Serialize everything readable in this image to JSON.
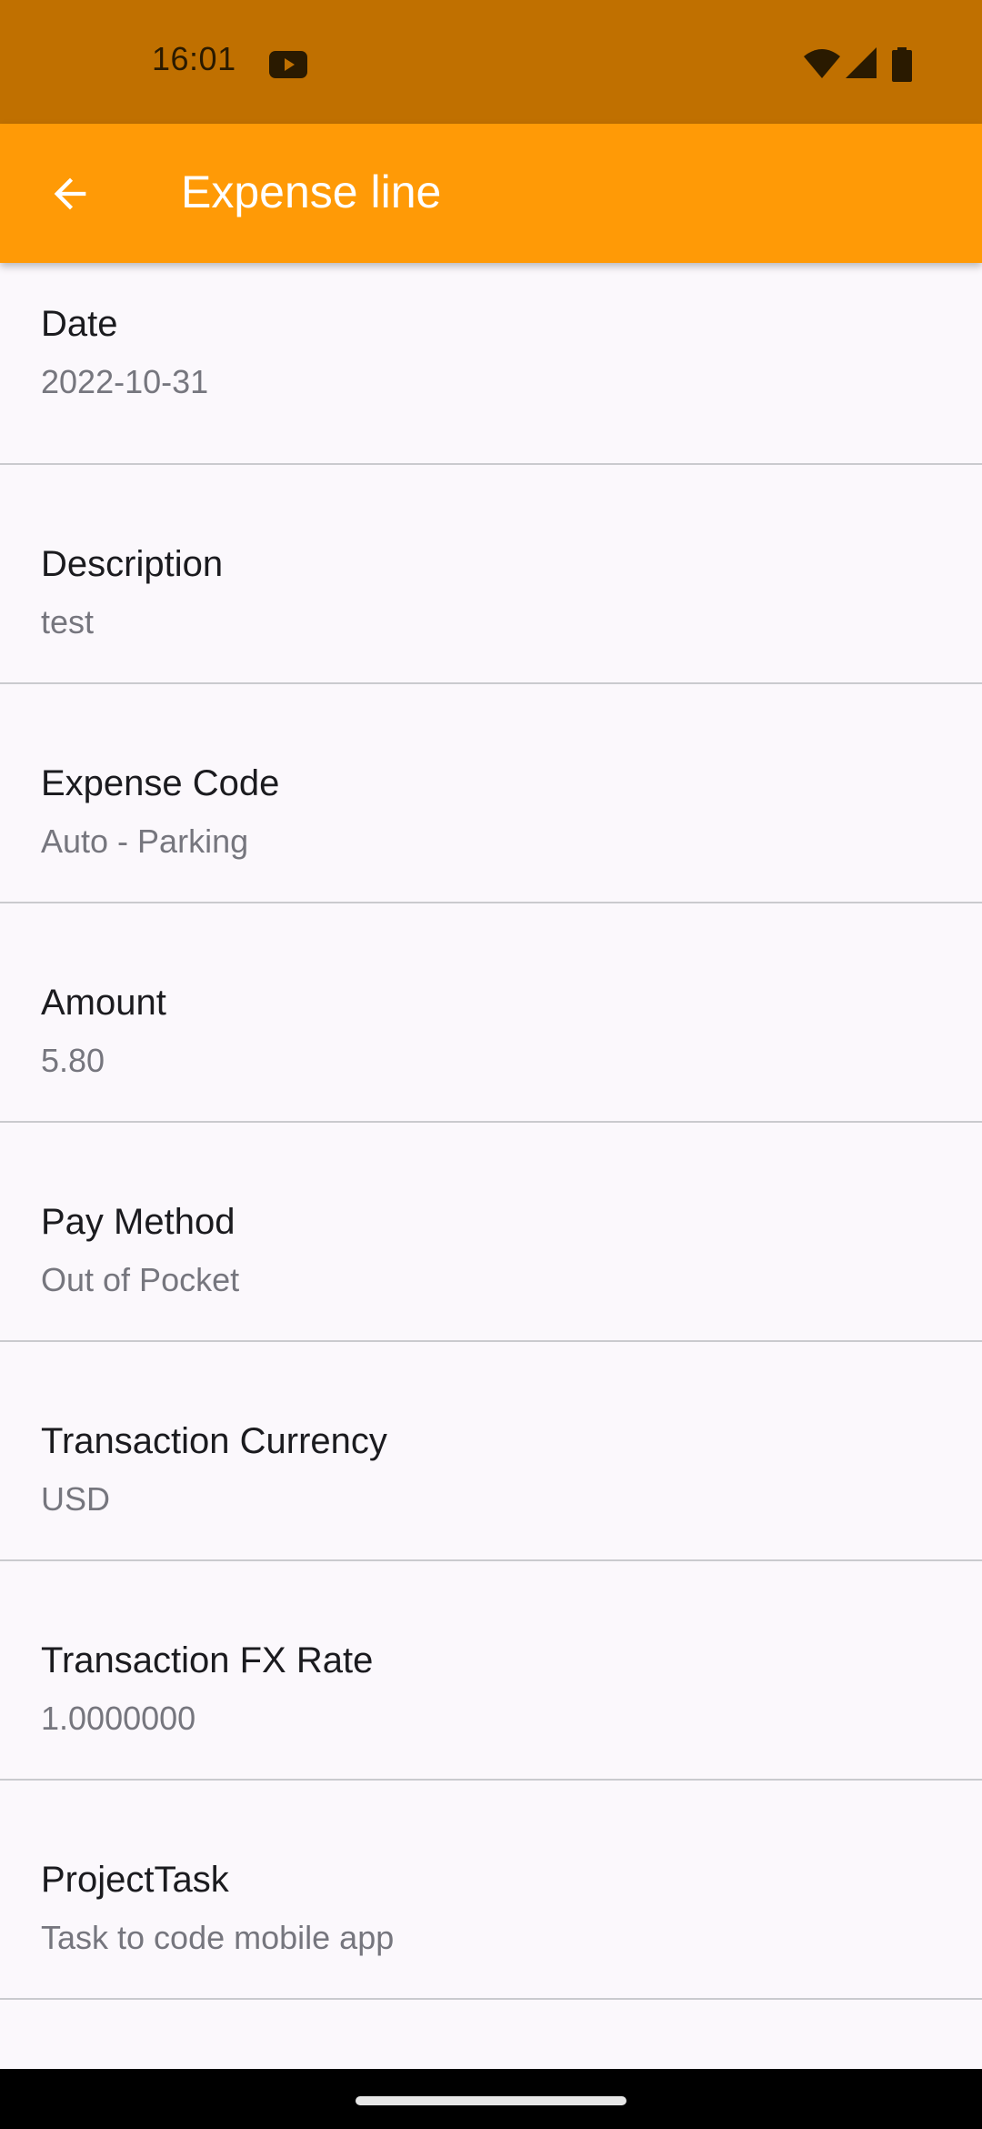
{
  "status_bar": {
    "time": "16:01",
    "icons": [
      "youtube-icon",
      "wifi-icon",
      "signal-icon",
      "battery-icon"
    ]
  },
  "app_bar": {
    "title": "Expense line",
    "back_icon": "arrow-back-icon",
    "background_color": "#FF9A06"
  },
  "fields": [
    {
      "label": "Date",
      "value": "2022-10-31"
    },
    {
      "label": "Description",
      "value": "test"
    },
    {
      "label": "Expense Code",
      "value": "Auto - Parking"
    },
    {
      "label": "Amount",
      "value": "5.80"
    },
    {
      "label": "Pay Method",
      "value": "Out of Pocket"
    },
    {
      "label": "Transaction Currency",
      "value": "USD"
    },
    {
      "label": "Transaction FX Rate",
      "value": "1.0000000"
    },
    {
      "label": "ProjectTask",
      "value": "Task to code mobile app"
    }
  ],
  "colors": {
    "status_bar": "#C07000",
    "accent": "#FF9A06",
    "background": "#FBF8FC",
    "label_text": "#1B1B1F",
    "value_text": "#76767E"
  }
}
